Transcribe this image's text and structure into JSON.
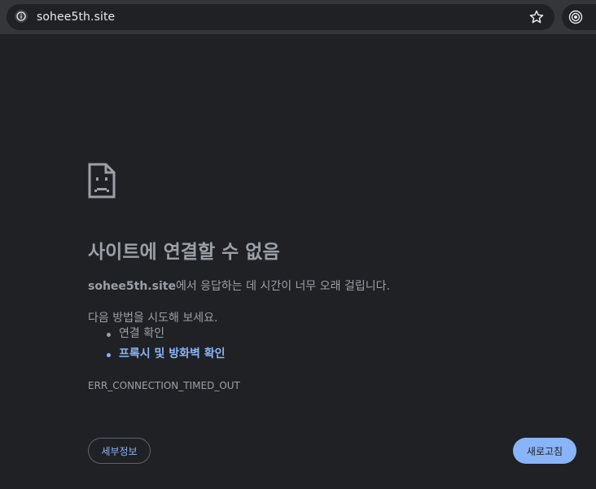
{
  "browser": {
    "url": "sohee5th.site",
    "info_icon": "info-icon",
    "bookmark_icon": "star-icon",
    "extension_icon": "target-icon"
  },
  "error": {
    "icon": "sad-page-icon",
    "title": "사이트에 연결할 수 없음",
    "summary_host": "sohee5th.site",
    "summary_rest": "에서 응답하는 데 시간이 너무 오래 걸립니다.",
    "try_intro": "다음 방법을 시도해 보세요.",
    "suggestions": [
      "연결 확인",
      "프록시 및 방화벽 확인"
    ],
    "code": "ERR_CONNECTION_TIMED_OUT"
  },
  "buttons": {
    "details": "세부정보",
    "reload": "새로고침"
  },
  "colors": {
    "background": "#202124",
    "text": "#9aa0a6",
    "link": "#8ab4f8",
    "reload_bg": "#8ab4f8"
  }
}
